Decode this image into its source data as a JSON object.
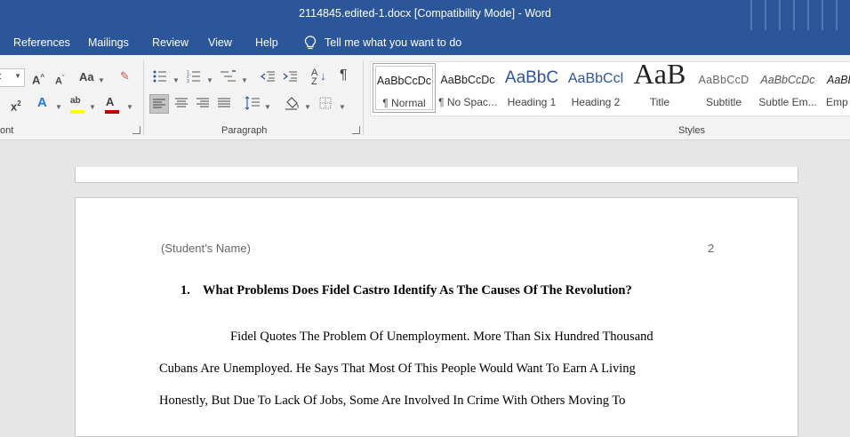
{
  "window": {
    "title": "2114845.edited-1.docx [Compatibility Mode]  -  Word"
  },
  "menu": {
    "items": [
      "References",
      "Mailings",
      "Review",
      "View",
      "Help"
    ],
    "tell_me": "Tell me what you want to do"
  },
  "ribbon": {
    "groups": {
      "font_partial": "ont",
      "paragraph": "Paragraph",
      "styles": "Styles"
    },
    "styles": [
      {
        "preview": "AaBbCcDc",
        "name": "¶ Normal"
      },
      {
        "preview": "AaBbCcDc",
        "name": "¶ No Spac..."
      },
      {
        "preview": "AaBbC",
        "name": "Heading 1"
      },
      {
        "preview": "AaBbCcl",
        "name": "Heading 2"
      },
      {
        "preview": "AaB",
        "name": "Title"
      },
      {
        "preview": "AaBbCcD",
        "name": "Subtitle"
      },
      {
        "preview": "AaBbCcDc",
        "name": "Subtle Em..."
      },
      {
        "preview": "AaBb",
        "name": "Emp"
      }
    ],
    "font_color": "#c00000",
    "highlight_color": "#ffff00",
    "accent": "#2b579a"
  },
  "document": {
    "header_left": "(Student’s Name)",
    "page_number": "2",
    "heading_number": "1.",
    "heading_text": "What Problems Does Fidel Castro Identify As The Causes Of The Revolution?",
    "paragraph_lines": [
      "Fidel Quotes The Problem Of Unemployment. More Than Six Hundred Thousand",
      "Cubans Are Unemployed. He Says That Most Of This People Would Want To Earn A Living",
      "Honestly, But Due To Lack Of Jobs, Some Are Involved In Crime With Others Moving To"
    ]
  }
}
